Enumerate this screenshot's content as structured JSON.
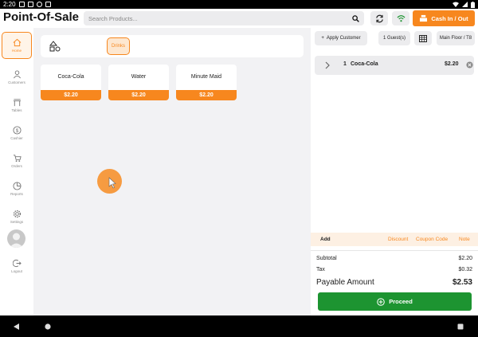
{
  "status_bar": {
    "time": "2:20"
  },
  "header": {
    "title": "Point-Of-Sale",
    "search_placeholder": "Search Products...",
    "cash_button": "Cash In / Out"
  },
  "sidebar": {
    "items": [
      {
        "label": "Home",
        "icon": "home-icon",
        "active": true
      },
      {
        "label": "Customers",
        "icon": "person-icon"
      },
      {
        "label": "Tables",
        "icon": "table-icon"
      },
      {
        "label": "Cashier",
        "icon": "dollar-icon"
      },
      {
        "label": "Orders",
        "icon": "cart-icon"
      },
      {
        "label": "Reports",
        "icon": "pie-chart-icon"
      },
      {
        "label": "Settings",
        "icon": "gear-icon"
      },
      {
        "label": "Logout",
        "icon": "logout-icon"
      }
    ]
  },
  "categories": {
    "active": "Drinks"
  },
  "products": [
    {
      "name": "Coca-Cola",
      "price": "$2.20"
    },
    {
      "name": "Water",
      "price": "$2.20"
    },
    {
      "name": "Minute Maid",
      "price": "$2.20"
    }
  ],
  "order_panel": {
    "add_customer": "Apply Customer",
    "guests": "1 Guest(s)",
    "table": "Main Floor / T8",
    "lines": [
      {
        "qty": "1",
        "name": "Coca-Cola",
        "price": "$2.20"
      }
    ],
    "actions": {
      "add": "Add",
      "discount": "Discount",
      "coupon": "Coupon Code",
      "note": "Note"
    },
    "totals": {
      "subtotal_label": "Subtotal",
      "subtotal": "$2.20",
      "tax_label": "Tax",
      "tax": "$0.32",
      "payable_label": "Payable Amount",
      "payable": "$2.53"
    },
    "proceed": "Proceed"
  },
  "colors": {
    "accent": "#f7871e",
    "proceed": "#1d9431"
  }
}
